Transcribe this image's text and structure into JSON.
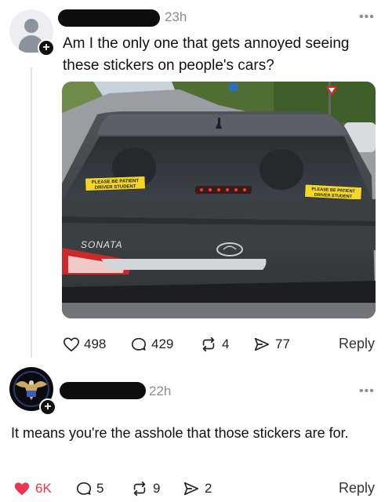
{
  "post": {
    "time": "23h",
    "more": "•••",
    "text": "Am I the only one that gets annoyed seeing these stickers on people's cars?",
    "photo": {
      "sticker_left_line1": "PLEASE BE PATIENT",
      "sticker_left_line2": "DRIVER STUDENT",
      "sticker_right_line1": "PLEASE BE PATIENT",
      "sticker_right_line2": "DRIVER STUDENT",
      "car_badge": "SONATA"
    },
    "likes": "498",
    "comments": "429",
    "reposts": "4",
    "shares": "77",
    "reply_label": "Reply"
  },
  "comment": {
    "time": "22h",
    "more": "•••",
    "text": "It means you're the asshole that those stickers are for.",
    "likes": "6K",
    "like_color": "#e8384f",
    "comments": "5",
    "reposts": "9",
    "shares": "2",
    "reply_label": "Reply"
  },
  "icons": {
    "avatar_default": "person-silhouette-icon",
    "avatar_commenter": "eagle-emblem-icon",
    "follow": "plus-icon",
    "like": "heart-icon",
    "comment": "speech-bubble-icon",
    "repost": "repost-arrows-icon",
    "share": "send-paper-plane-icon"
  }
}
